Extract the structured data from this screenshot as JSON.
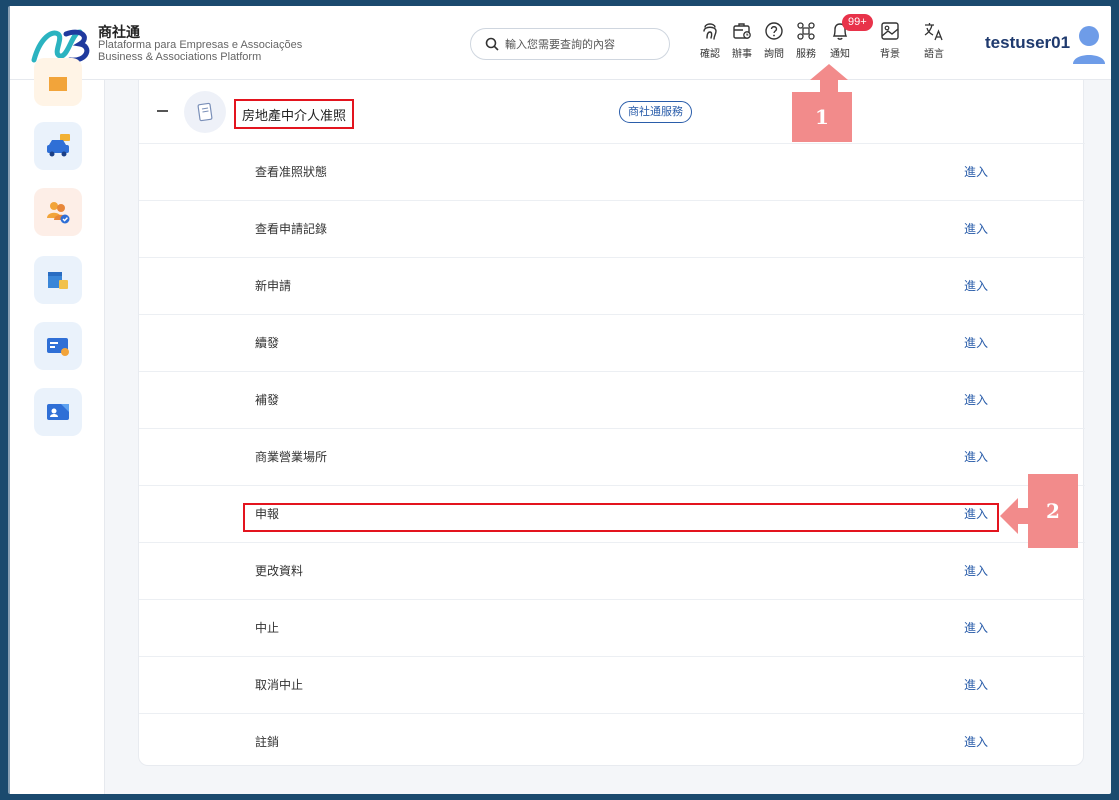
{
  "header": {
    "brand_title": "商社通",
    "brand_sub_1": "Plataforma para Empresas e Associações",
    "brand_sub_2": "Business & Associations Platform",
    "search_placeholder": "輸入您需要查詢的內容",
    "tools": [
      {
        "label": "確認",
        "icon": "fingerprint-icon"
      },
      {
        "label": "辦事",
        "icon": "briefcase-icon"
      },
      {
        "label": "詢問",
        "icon": "question-icon"
      },
      {
        "label": "服務",
        "icon": "command-icon"
      },
      {
        "label": "通知",
        "icon": "bell-icon"
      },
      {
        "label": "背景",
        "icon": "image-icon"
      },
      {
        "label": "語言",
        "icon": "translate-icon"
      }
    ],
    "notification_badge": "99+",
    "username": "testuser01"
  },
  "rail": {
    "icons": [
      "building-icon",
      "car-icon",
      "people-check-icon",
      "shop-icon",
      "card-icon",
      "id-card-icon"
    ]
  },
  "group": {
    "title": "房地產中介人准照",
    "tag": "商社通服務"
  },
  "rows": [
    {
      "name": "查看准照狀態",
      "action": "進入"
    },
    {
      "name": "查看申請記錄",
      "action": "進入"
    },
    {
      "name": "新申請",
      "action": "進入"
    },
    {
      "name": "續發",
      "action": "進入"
    },
    {
      "name": "補發",
      "action": "進入"
    },
    {
      "name": "商業營業場所",
      "action": "進入"
    },
    {
      "name": "申報",
      "action": "進入"
    },
    {
      "name": "更改資料",
      "action": "進入"
    },
    {
      "name": "中止",
      "action": "進入"
    },
    {
      "name": "取消中止",
      "action": "進入"
    },
    {
      "name": "註銷",
      "action": "進入"
    }
  ],
  "annotations": {
    "step1": "1",
    "step2": "2"
  },
  "colors": {
    "accent": "#2a5daa",
    "highlight": "#e3141e",
    "callout": "#f28b8b",
    "badge": "#e8334a"
  }
}
